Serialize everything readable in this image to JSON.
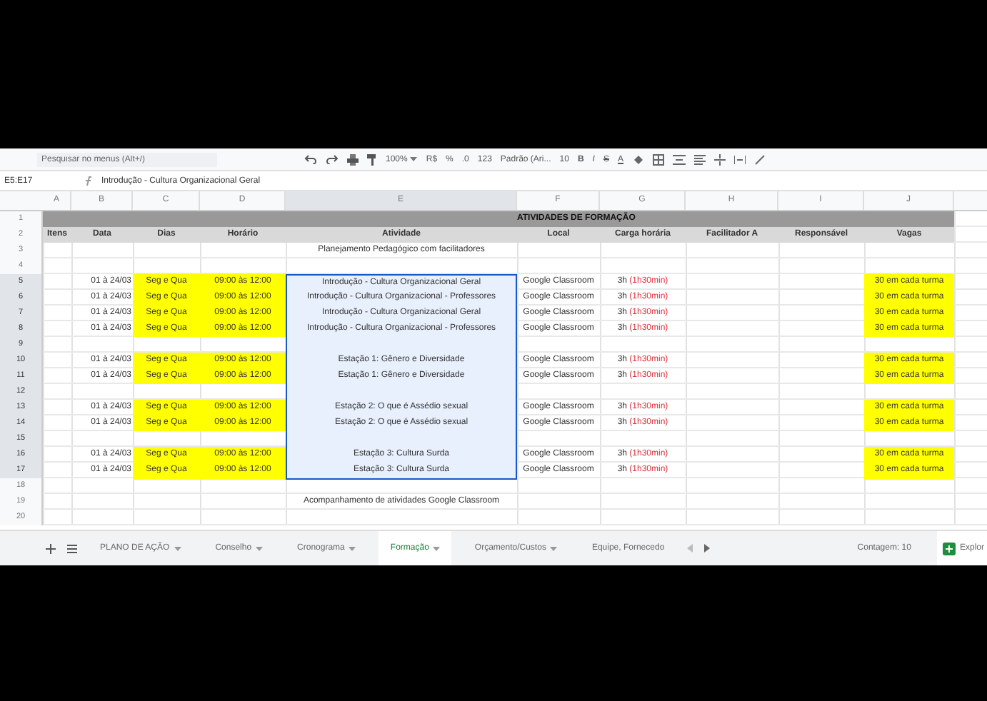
{
  "toolbar": {
    "search": {
      "placeholder": "Pesquisar no menus (Alt+/)"
    },
    "zoom": "100%",
    "currency": "R$",
    "percent": "%",
    "decimals": ".0",
    "more_formats": "123",
    "font": "Padrão (Ari...",
    "font_size": "10",
    "format_buttons": [
      {
        "label": "B",
        "kind": "bold"
      },
      {
        "label": "I",
        "kind": "italic"
      },
      {
        "label": "S",
        "kind": "strike"
      },
      {
        "label": "A",
        "kind": "color"
      }
    ]
  },
  "formula_bar": {
    "cell_ref": "E5:E17",
    "formula": "Introdução - Cultura Organizacional Geral"
  },
  "columns": [
    "A",
    "B",
    "C",
    "D",
    "E",
    "F",
    "G",
    "H",
    "I",
    "J"
  ],
  "title": "ATIVIDADES DE FORMAÇÃO",
  "headers": [
    "Itens",
    "Data",
    "Dias",
    "Horário",
    "Atividade",
    "Local",
    "Carga horária",
    "Facilitador A",
    "Responsável",
    "Vagas"
  ],
  "rows": [
    {
      "n": "1",
      "kind": "title",
      "selected": false
    },
    {
      "n": "2",
      "kind": "header",
      "selected": false
    },
    {
      "n": "3",
      "kind": "note",
      "text": "Planejamento Pedagógico com facilitadores",
      "selected": false
    },
    {
      "n": "4",
      "kind": "blank",
      "selected": false
    },
    {
      "n": "5",
      "kind": "entry",
      "date": "01 à 24/03",
      "days": "Seg e Qua",
      "time": "09:00 às 12:00",
      "activity": "Introdução - Cultura Organizacional Geral",
      "local": "Google Classroom",
      "hours": "3h",
      "hours_detail": "(1h30min)",
      "vagas": "30 em cada turma",
      "selected": true
    },
    {
      "n": "6",
      "kind": "entry",
      "date": "01 à 24/03",
      "days": "Seg e Qua",
      "time": "09:00 às 12:00",
      "activity": "Introdução - Cultura Organizacional - Professores",
      "local": "Google Classroom",
      "hours": "3h",
      "hours_detail": "(1h30min)",
      "vagas": "30 em cada turma",
      "selected": true
    },
    {
      "n": "7",
      "kind": "entry",
      "date": "01 à 24/03",
      "days": "Seg e Qua",
      "time": "09:00 às 12:00",
      "activity": "Introdução - Cultura Organizacional Geral",
      "local": "Google Classroom",
      "hours": "3h",
      "hours_detail": "(1h30min)",
      "vagas": "30 em cada turma",
      "selected": true
    },
    {
      "n": "8",
      "kind": "entry",
      "date": "01 à 24/03",
      "days": "Seg e Qua",
      "time": "09:00 às 12:00",
      "activity": "Introdução - Cultura Organizacional - Professores",
      "local": "Google Classroom",
      "hours": "3h",
      "hours_detail": "(1h30min)",
      "vagas": "30 em cada turma",
      "selected": true
    },
    {
      "n": "9",
      "kind": "blank",
      "selected": true
    },
    {
      "n": "10",
      "kind": "entry",
      "date": "01 à 24/03",
      "days": "Seg e Qua",
      "time": "09:00 às 12:00",
      "activity": "Estação 1: Gênero e Diversidade",
      "local": "Google Classroom",
      "hours": "3h",
      "hours_detail": "(1h30min)",
      "vagas": "30 em cada turma",
      "selected": true
    },
    {
      "n": "11",
      "kind": "entry",
      "date": "01 à 24/03",
      "days": "Seg e Qua",
      "time": "09:00 às 12:00",
      "activity": "Estação 1: Gênero e Diversidade",
      "local": "Google Classroom",
      "hours": "3h",
      "hours_detail": "(1h30min)",
      "vagas": "30 em cada turma",
      "selected": true
    },
    {
      "n": "12",
      "kind": "blank",
      "selected": true
    },
    {
      "n": "13",
      "kind": "entry",
      "date": "01 à 24/03",
      "days": "Seg e Qua",
      "time": "09:00 às 12:00",
      "activity": "Estação 2: O que é Assédio sexual",
      "local": "Google Classroom",
      "hours": "3h",
      "hours_detail": "(1h30min)",
      "vagas": "30 em cada turma",
      "selected": true
    },
    {
      "n": "14",
      "kind": "entry",
      "date": "01 à 24/03",
      "days": "Seg e Qua",
      "time": "09:00 às 12:00",
      "activity": "Estação 2: O que é Assédio sexual",
      "local": "Google Classroom",
      "hours": "3h",
      "hours_detail": "(1h30min)",
      "vagas": "30 em cada turma",
      "selected": true
    },
    {
      "n": "15",
      "kind": "blank",
      "selected": true
    },
    {
      "n": "16",
      "kind": "entry",
      "date": "01 à 24/03",
      "days": "Seg e Qua",
      "time": "09:00 às 12:00",
      "activity": "Estação 3: Cultura Surda",
      "local": "Google Classroom",
      "hours": "3h",
      "hours_detail": "(1h30min)",
      "vagas": "30 em cada turma",
      "selected": true
    },
    {
      "n": "17",
      "kind": "entry",
      "date": "01 à 24/03",
      "days": "Seg e Qua",
      "time": "09:00 às 12:00",
      "activity": "Estação 3: Cultura Surda",
      "local": "Google Classroom",
      "hours": "3h",
      "hours_detail": "(1h30min)",
      "vagas": "30 em cada turma",
      "selected": true
    },
    {
      "n": "18",
      "kind": "blank",
      "selected": false
    },
    {
      "n": "19",
      "kind": "note",
      "text": "Acompanhamento de atividades Google Classroom",
      "selected": false
    },
    {
      "n": "20",
      "kind": "blank",
      "selected": false
    }
  ],
  "sheet_tabs": [
    {
      "label": "PLANO DE AÇÃO",
      "selected": false
    },
    {
      "label": "Conselho",
      "selected": false
    },
    {
      "label": "Cronograma",
      "selected": false
    },
    {
      "label": "Formação",
      "selected": true
    },
    {
      "label": "Orçamento/Custos",
      "selected": false
    },
    {
      "label": "Equipe, Fornecedo",
      "selected": false
    }
  ],
  "status": {
    "count": "Contagem: 10",
    "explore": "Explor"
  }
}
